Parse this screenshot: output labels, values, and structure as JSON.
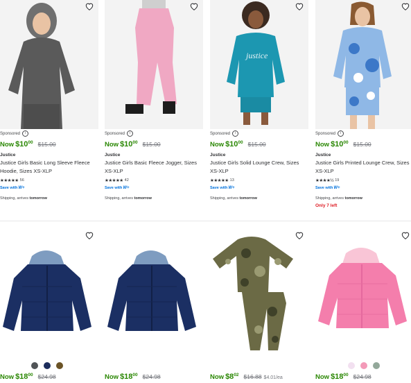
{
  "products": [
    {
      "sponsored_label": "Sponsored",
      "price_prefix": "Now",
      "price_dollars": "$10",
      "price_cents": "00",
      "was_price": "$15.00",
      "brand": "Justice",
      "title": "Justice Girls Basic Long Sleeve Fleece Hoodie, Sizes XS-XLP",
      "stars": "★★★★★",
      "review_count": "56",
      "save_with": "Save with",
      "walmart_plus": "W+",
      "shipping_text": "Shipping, arrives",
      "shipping_day": "tomorrow",
      "image_icon": "girl-grey-hoodie-icon",
      "colors": {
        "bg": "#f3f3f3",
        "garment": "#5a5a5a"
      }
    },
    {
      "sponsored_label": "Sponsored",
      "price_prefix": "Now",
      "price_dollars": "$10",
      "price_cents": "00",
      "was_price": "$15.00",
      "brand": "Justice",
      "title": "Justice Girls Basic Fleece Jogger, Sizes XS-XLP",
      "stars": "★★★★★",
      "review_count": "42",
      "save_with": "Save with",
      "walmart_plus": "W+",
      "shipping_text": "Shipping, arrives",
      "shipping_day": "tomorrow",
      "image_icon": "girl-pink-jogger-icon",
      "colors": {
        "bg": "#f3f3f3",
        "garment": "#f0a8c3"
      }
    },
    {
      "sponsored_label": "Sponsored",
      "price_prefix": "Now",
      "price_dollars": "$10",
      "price_cents": "00",
      "was_price": "$15.00",
      "brand": "Justice",
      "title": "Justice Girls Solid Lounge Crew, Sizes XS-XLP",
      "stars": "★★★★★",
      "review_count": "13",
      "save_with": "Save with",
      "walmart_plus": "W+",
      "shipping_text": "Shipping, arrives",
      "shipping_day": "tomorrow",
      "image_icon": "girl-teal-crew-icon",
      "colors": {
        "bg": "#f3f3f3",
        "garment": "#1c97b1"
      }
    },
    {
      "sponsored_label": "Sponsored",
      "price_prefix": "Now",
      "price_dollars": "$10",
      "price_cents": "00",
      "was_price": "$15.00",
      "brand": "Justice",
      "title": "Justice Girls Printed Lounge Crew, Sizes XS-XLP",
      "stars": "★★★★½",
      "review_count": "19",
      "save_with": "Save with",
      "walmart_plus": "W+",
      "shipping_text": "Shipping, arrives",
      "shipping_day": "tomorrow",
      "stock_text": "Only 7 left",
      "image_icon": "girl-tie-dye-crew-icon",
      "colors": {
        "bg": "#f3f3f3",
        "garment": "#8fb8e6"
      }
    },
    {
      "price_prefix": "Now",
      "price_dollars": "$18",
      "price_cents": "00",
      "was_price": "$24.98",
      "image_icon": "navy-puffer-jacket-icon",
      "swatches": [
        "#505457",
        "#1d2d5c",
        "#6b5326"
      ],
      "colors": {
        "garment": "#1b2f63",
        "hood": "#7e9cc0"
      }
    },
    {
      "price_prefix": "Now",
      "price_dollars": "$18",
      "price_cents": "00",
      "was_price": "$24.98",
      "image_icon": "navy-puffer-jacket-icon",
      "colors": {
        "garment": "#1b2f63",
        "hood": "#7e9cc0"
      }
    },
    {
      "price_prefix": "Now",
      "price_dollars": "$8",
      "price_cents": "02",
      "was_price": "$16.88",
      "unit_price": "$4.01/ea",
      "image_icon": "camo-pajama-set-icon",
      "colors": {
        "garment": "#6b6a45",
        "camo2": "#3f4129",
        "camo3": "#9a9a72"
      }
    },
    {
      "price_prefix": "Now",
      "price_dollars": "$18",
      "price_cents": "00",
      "was_price": "$24.98",
      "image_icon": "pink-puffer-jacket-icon",
      "swatches": [
        "#f2e0f0",
        "#f39ab8",
        "#93a89a"
      ],
      "colors": {
        "garment": "#f47eac",
        "hood": "#f9c5d6"
      }
    }
  ],
  "icons": {
    "favorite": "heart-outline-icon",
    "info": "info-icon"
  },
  "accent_colors": {
    "price_green": "#2a8703",
    "walmart_blue": "#0071dc",
    "stock_red": "#de1c24"
  }
}
